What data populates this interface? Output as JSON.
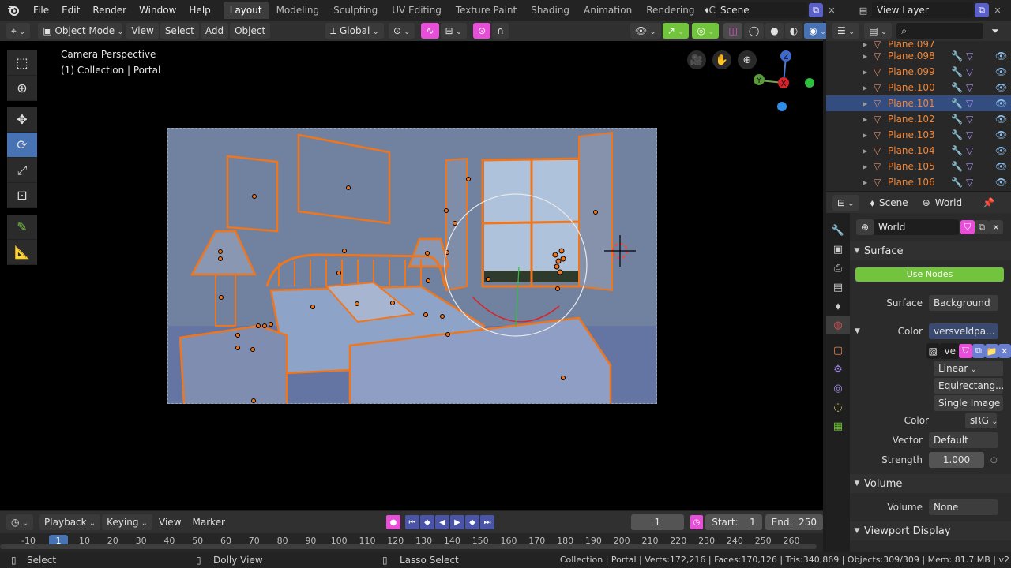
{
  "menu": {
    "items": [
      "File",
      "Edit",
      "Render",
      "Window",
      "Help"
    ],
    "workspaces": [
      "Layout",
      "Modeling",
      "Sculpting",
      "UV Editing",
      "Texture Paint",
      "Shading",
      "Animation",
      "Rendering",
      "Compositing"
    ],
    "active_workspace": "Layout",
    "scene": "Scene",
    "view_layer": "View Layer"
  },
  "viewport_header": {
    "mode": "Object Mode",
    "view": "View",
    "select": "Select",
    "add": "Add",
    "object": "Object",
    "orientation": "Global"
  },
  "viewport": {
    "info_line1": "Camera Perspective",
    "info_line2": "(1) Collection | Portal",
    "gizmo": {
      "x": "X",
      "y": "Y",
      "z": "Z"
    }
  },
  "outliner": {
    "partial_top": "Plane.097",
    "rows": [
      {
        "name": "Plane.098",
        "selected": false
      },
      {
        "name": "Plane.099",
        "selected": false
      },
      {
        "name": "Plane.100",
        "selected": false
      },
      {
        "name": "Plane.101",
        "selected": true
      },
      {
        "name": "Plane.102",
        "selected": false
      },
      {
        "name": "Plane.103",
        "selected": false
      },
      {
        "name": "Plane.104",
        "selected": false
      },
      {
        "name": "Plane.105",
        "selected": false
      },
      {
        "name": "Plane.106",
        "selected": false
      }
    ]
  },
  "properties": {
    "breadcrumb_scene": "Scene",
    "breadcrumb_world": "World",
    "world_name": "World",
    "surface_section": "Surface",
    "use_nodes": "Use Nodes",
    "surface_label": "Surface",
    "surface_value": "Background",
    "color_label": "Color",
    "color_value": "versveldpa...",
    "image_name": "ve",
    "interpolation": "Linear",
    "projection": "Equirectang...",
    "source": "Single Image",
    "colorspace_label": "Color",
    "colorspace_value": "sRG",
    "vector_label": "Vector",
    "vector_value": "Default",
    "strength_label": "Strength",
    "strength_value": "1.000",
    "volume_section": "Volume",
    "volume_label": "Volume",
    "volume_value": "None",
    "viewport_display_section": "Viewport Display"
  },
  "timeline": {
    "playback": "Playback",
    "keying": "Keying",
    "view": "View",
    "marker": "Marker",
    "current_frame": "1",
    "start_label": "Start:",
    "start": "1",
    "end_label": "End:",
    "end": "250",
    "ruler_ticks": [
      "-10",
      "1",
      "10",
      "20",
      "30",
      "40",
      "50",
      "60",
      "70",
      "80",
      "90",
      "100",
      "110",
      "120",
      "130",
      "140",
      "150",
      "160",
      "170",
      "180",
      "190",
      "200",
      "210",
      "220",
      "230",
      "240",
      "250",
      "260"
    ]
  },
  "statusbar": {
    "select": "Select",
    "dolly": "Dolly View",
    "lasso": "Lasso Select",
    "stats": "Collection | Portal | Verts:172,216 | Faces:170,126 | Tris:340,869 | Objects:309/309 | Mem: 81.7 MB | v2"
  },
  "colors": {
    "accent_blue": "#4772b3",
    "selection_orange": "#f08436",
    "use_nodes_green": "#71c43c",
    "timeline_button": "#4a55a8"
  }
}
